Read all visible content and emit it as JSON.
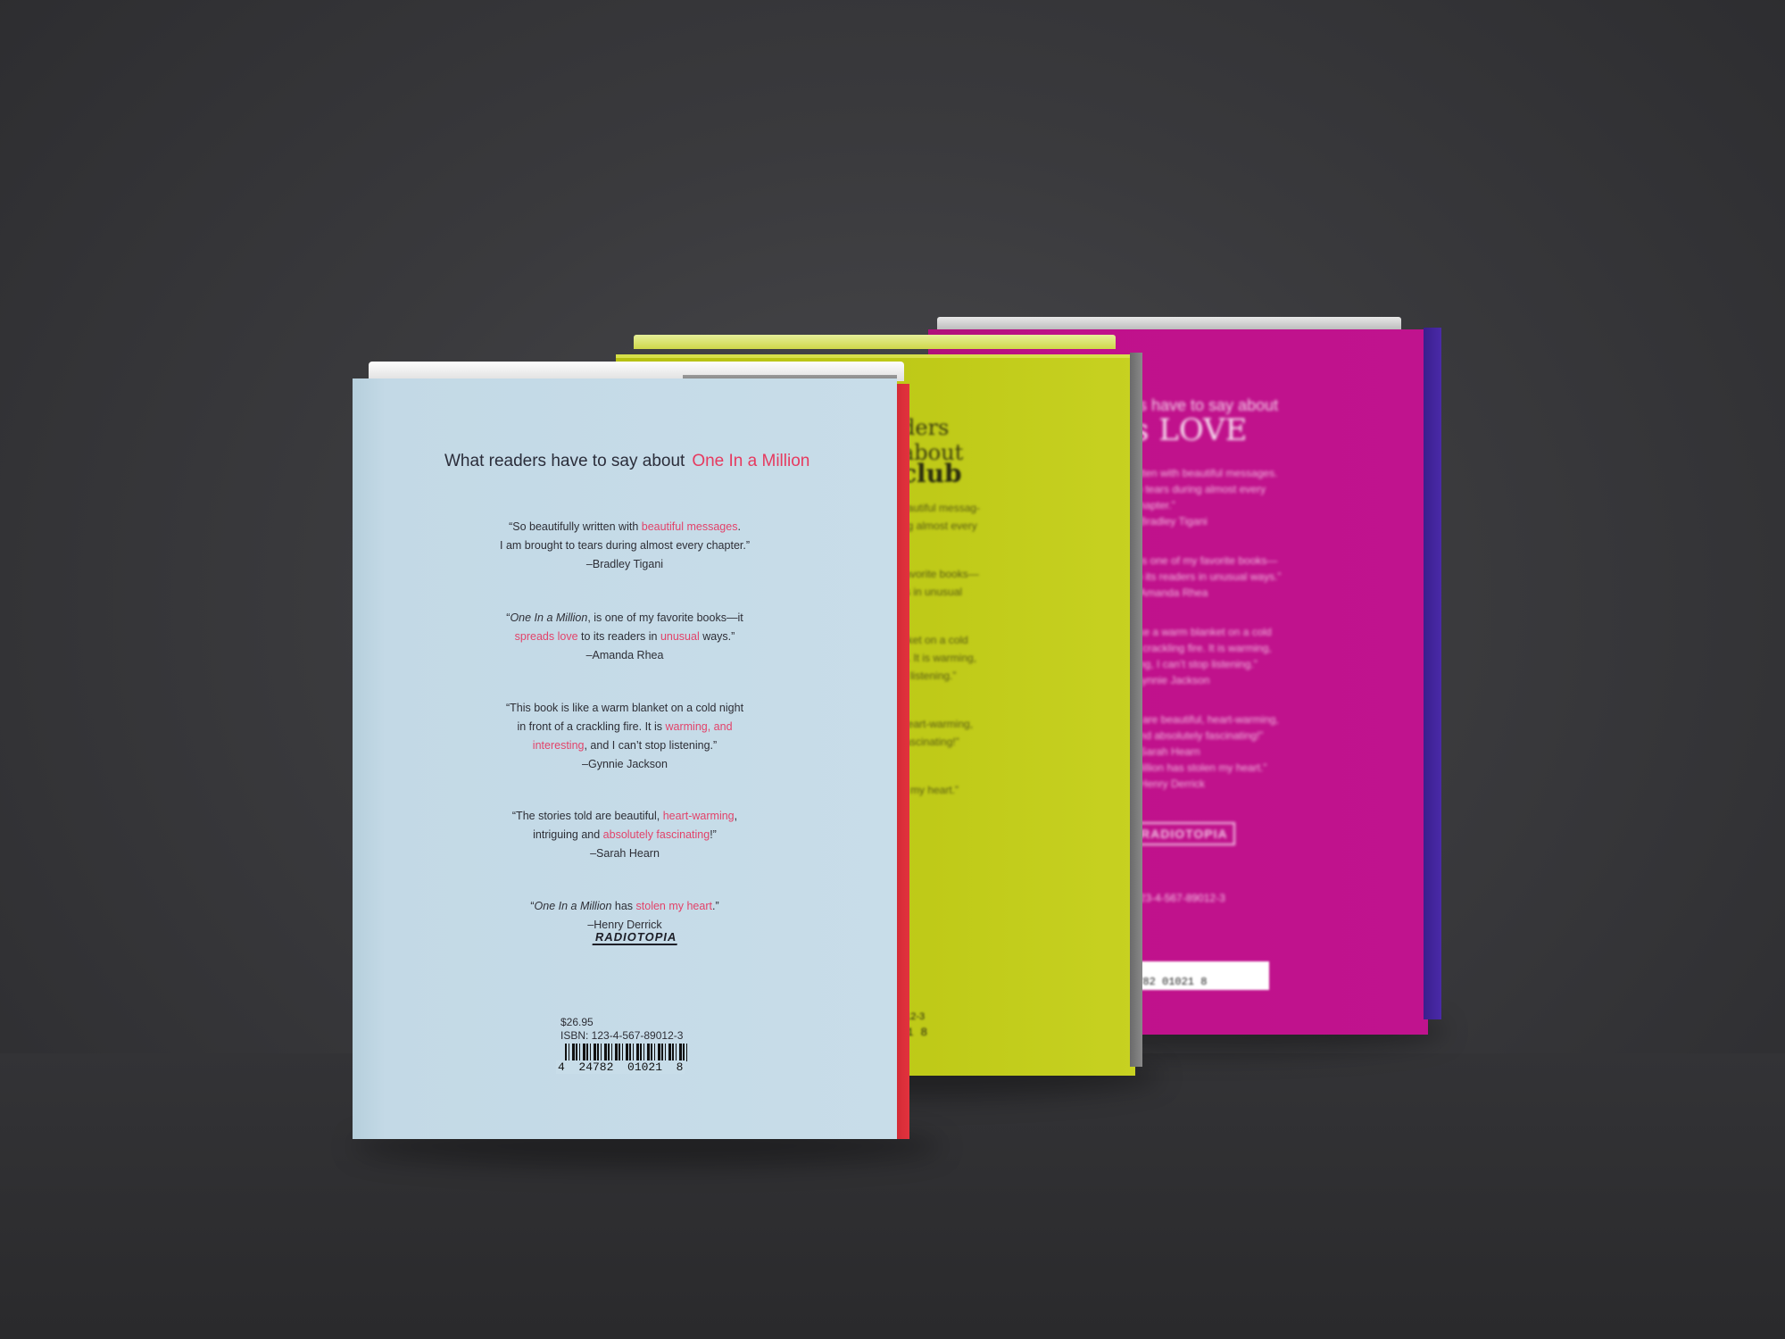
{
  "books": {
    "front": {
      "heading": "What readers have to say about",
      "title": "One In a Million",
      "quotes": [
        {
          "line1_a": "“So beautifully written with ",
          "line1_hl": "beautiful messages",
          "line1_b": ".",
          "line2": "I am brought to tears during almost every chapter.”",
          "attr": "–Bradley Tigani"
        },
        {
          "line1_a": "“",
          "line1_em": "One In a Million",
          "line1_b": ", is one of my favorite books—it",
          "line2_hl": "spreads love",
          "line2_a": " to its readers in ",
          "line2_hl2": "unusual",
          "line2_b": " ways.”",
          "attr": "–Amanda Rhea"
        },
        {
          "line1": "“This book is like a warm blanket on a cold night",
          "line2_a": "in front of a crackling fire. It is ",
          "line2_hl": "warming, and",
          "line3_hl": "interesting",
          "line3_b": ", and I can’t stop listening.”",
          "attr": "–Gynnie Jackson"
        },
        {
          "line1_a": "“The stories told are beautiful, ",
          "line1_hl": "heart-warming",
          "line1_b": ",",
          "line2_a": "intriguing and ",
          "line2_hl": "absolutely fascinating",
          "line2_b": "!”",
          "attr": "–Sarah Hearn"
        },
        {
          "line1_a": "“",
          "line1_em": "One In a Million",
          "line1_b": " has ",
          "line1_hl": "stolen my heart",
          "line1_c": ".”",
          "attr": "–Henry Derrick"
        }
      ],
      "publisher": "RADIOTOPIA",
      "price": "$26.95",
      "isbn": "ISBN: 123-4-567-89012-3",
      "barcode_number": "4  24782  01021  8"
    },
    "middle": {
      "heading_1": "ders",
      "heading_2": "about",
      "title": "club",
      "quote_fragments": [
        "eautiful messag-",
        "ng almost every",
        "favorite books—",
        "rs in unusual",
        "nket on a cold",
        "e. It is warming,",
        "p listening.”",
        "heart-warming,",
        "fascinating!”",
        "n my heart.”"
      ],
      "isbn_fragment": "012-3",
      "barcode_fragment": "21  8"
    },
    "back": {
      "heading": "rs have to say about",
      "title": "s LOVE",
      "quote_fragments": [
        "ritten with beautiful messages.",
        "to tears during almost every",
        "chapter.”",
        "–Bradley Tigani",
        ", is one of my favorite books—",
        "to its readers in unusual ways.”",
        "–Amanda Rhea",
        "like a warm blanket on a cold",
        "a crackling fire. It is warming,",
        "ting, I can’t stop listening.”",
        "Gynnie Jackson",
        "d are beautiful, heart-warming,",
        "and absolutely fascinating!”",
        "–Sarah Hearn",
        "Million has stolen my heart.”",
        "–Henry Derrick"
      ],
      "publisher": "RADIOTOPIA",
      "isbn_fragment": "123-4-567-89012-3",
      "barcode_number": "4782  01021  8"
    }
  },
  "colors": {
    "front_cover": "#c8dde9",
    "accent_pink": "#e63a5f",
    "middle_cover": "#bfca18",
    "back_cover": "#c0118b",
    "background": "#3a3a3d"
  }
}
